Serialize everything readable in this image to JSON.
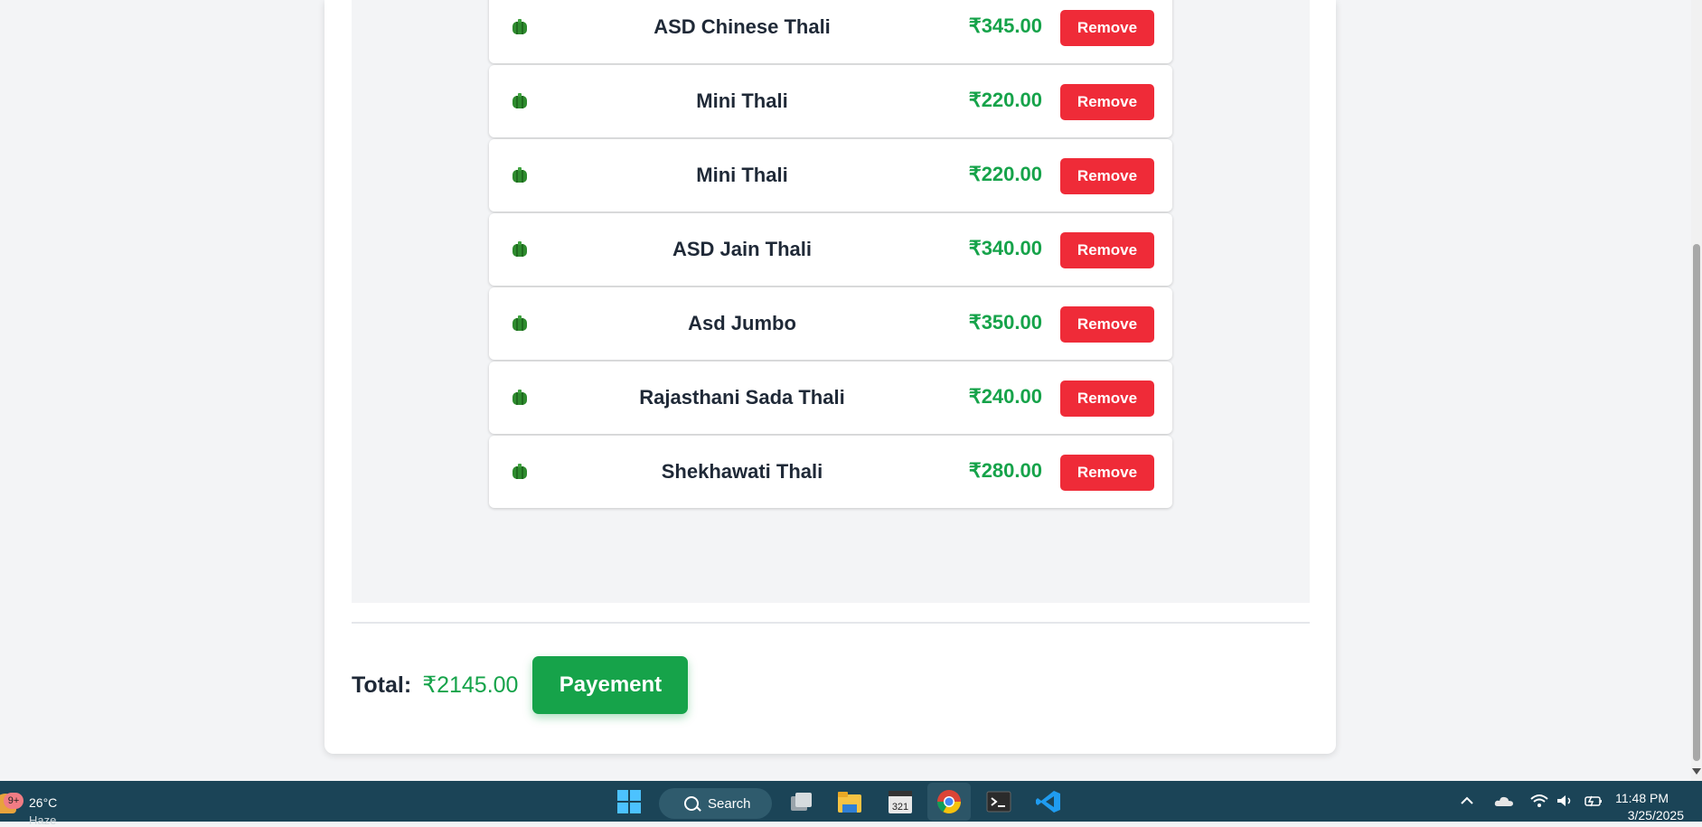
{
  "cart": {
    "items": [
      {
        "name": "ASD Chinese Thali",
        "price": "₹345.00",
        "remove_label": "Remove"
      },
      {
        "name": "Mini Thali",
        "price": "₹220.00",
        "remove_label": "Remove"
      },
      {
        "name": "Mini Thali",
        "price": "₹220.00",
        "remove_label": "Remove"
      },
      {
        "name": "ASD Jain Thali",
        "price": "₹340.00",
        "remove_label": "Remove"
      },
      {
        "name": "Asd Jumbo",
        "price": "₹350.00",
        "remove_label": "Remove"
      },
      {
        "name": "Rajasthani Sada Thali",
        "price": "₹240.00",
        "remove_label": "Remove"
      },
      {
        "name": "Shekhawati Thali",
        "price": "₹280.00",
        "remove_label": "Remove"
      }
    ],
    "total_label": "Total:",
    "total_value": "₹2145.00",
    "payment_label": "Payement"
  },
  "colors": {
    "price": "#16a34a",
    "remove": "#ef2b38",
    "payment": "#16a34a"
  },
  "taskbar": {
    "weather_badge": "9+",
    "weather_temp": "26°C",
    "weather_condition": "Haze",
    "search_label": "Search",
    "time": "11:48 PM",
    "date": "3/25/2025",
    "icons": [
      "start-icon",
      "search-icon",
      "task-view-icon",
      "file-explorer-icon",
      "media-player-icon",
      "chrome-icon",
      "terminal-icon",
      "vscode-icon",
      "chevron-up-icon",
      "onedrive-icon",
      "wifi-icon",
      "volume-icon",
      "battery-icon"
    ]
  }
}
